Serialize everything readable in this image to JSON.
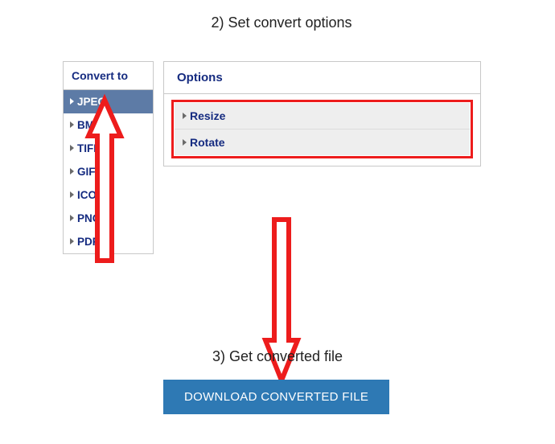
{
  "step2": "2) Set convert options",
  "step3": "3) Get converted file",
  "sidebar": {
    "header": "Convert to",
    "items": [
      {
        "label": "JPEG",
        "selected": true
      },
      {
        "label": "BMP"
      },
      {
        "label": "TIFF"
      },
      {
        "label": "GIF"
      },
      {
        "label": "ICO"
      },
      {
        "label": "PNG"
      },
      {
        "label": "PDF"
      }
    ]
  },
  "options": {
    "header": "Options",
    "rows": [
      {
        "label": "Resize"
      },
      {
        "label": "Rotate"
      }
    ]
  },
  "download": "DOWNLOAD CONVERTED FILE"
}
